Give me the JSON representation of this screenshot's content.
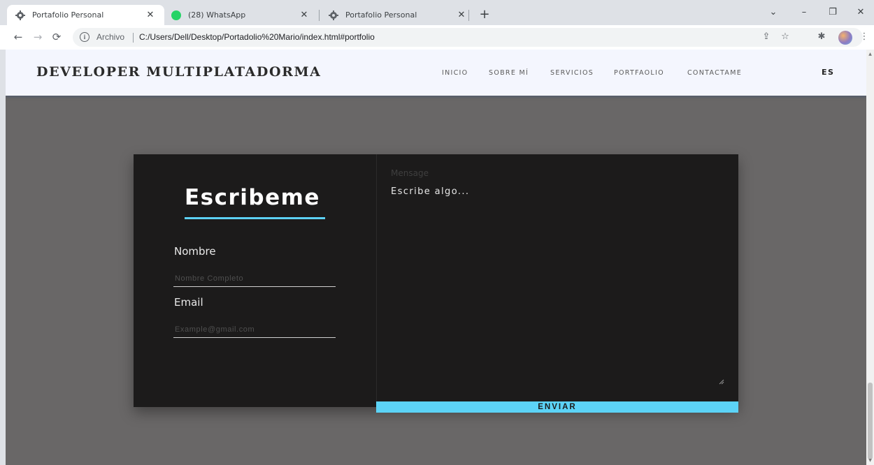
{
  "browser": {
    "tabs": [
      {
        "title": "Portafolio Personal",
        "active": true,
        "icon": "gear-favicon-icon"
      },
      {
        "title": "(28) WhatsApp",
        "active": false,
        "icon": "whatsapp-icon",
        "badge": "28"
      },
      {
        "title": "Portafolio Personal",
        "active": false,
        "icon": "gear-favicon-icon"
      }
    ],
    "close_glyph": "✕",
    "new_tab_glyph": "+",
    "address": {
      "scheme_label": "Archivo",
      "url": "C:/Users/Dell/Desktop/Portadolio%20Mario/index.html#portfolio"
    },
    "window_controls": {
      "dropdown": "⌄",
      "minimize": "–",
      "maximize": "❐",
      "close": "✕"
    },
    "toolbar_icons": [
      "share-icon",
      "star-icon",
      "puzzle-extensions-icon",
      "profile-avatar-icon",
      "menu-kebab-icon"
    ]
  },
  "site": {
    "brand": "DEVELOPER MULTIPLATADORMA",
    "nav": [
      {
        "label": "INICIO"
      },
      {
        "label": "SOBRE MÍ"
      },
      {
        "label": "SERVICIOS"
      },
      {
        "label": "PORTFAOLIO"
      },
      {
        "label": "CONTACTAME"
      }
    ],
    "lang": "ES"
  },
  "form": {
    "title": "Escribeme",
    "name_label": "Nombre",
    "name_placeholder": "Nombre Completo",
    "email_label": "Email",
    "email_placeholder": "Example@gmail.com",
    "message_label": "Mensage",
    "message_placeholder": "Escribe algo...",
    "submit_label": "ENVIAR"
  },
  "colors": {
    "accent": "#5cd3f7",
    "card_bg": "#1c1b1b",
    "page_bg": "#696767",
    "header_bg": "#f4f6fe"
  }
}
